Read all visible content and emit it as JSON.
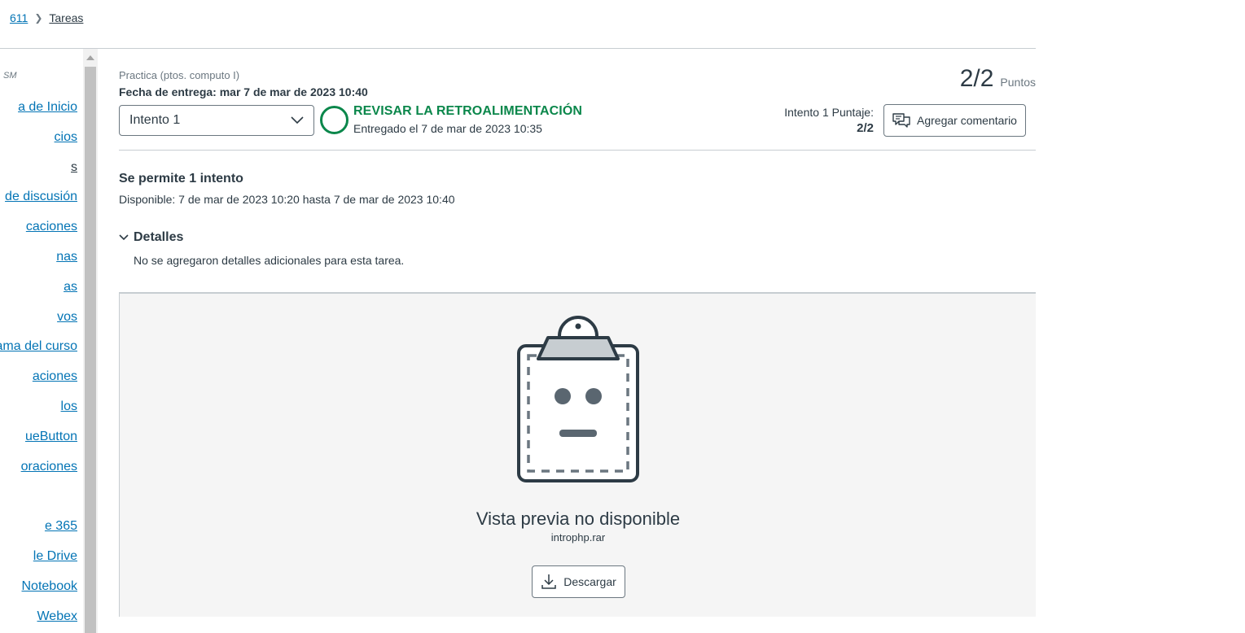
{
  "breadcrumb": {
    "course": "611",
    "section": "Tareas"
  },
  "sidebar": {
    "term": "SM",
    "items": [
      {
        "label": "a de Inicio"
      },
      {
        "label": "cios"
      },
      {
        "label": "s"
      },
      {
        "label": " de discusión"
      },
      {
        "label": "caciones"
      },
      {
        "label": "nas"
      },
      {
        "label": "as"
      },
      {
        "label": "vos"
      },
      {
        "label": "ama del curso"
      },
      {
        "label": "aciones"
      },
      {
        "label": "los"
      },
      {
        "label": "ueButton"
      },
      {
        "label": "oraciones"
      },
      {
        "label": "e 365"
      },
      {
        "label": "le Drive"
      },
      {
        "label": " Notebook"
      },
      {
        "label": " Webex"
      }
    ]
  },
  "assignment": {
    "practice_label": "Practica (ptos. computo I)",
    "due_date": "Fecha de entrega: mar 7 de mar de 2023 10:40",
    "score": "2/2",
    "score_unit": "Puntos",
    "attempt_selected": "Intento 1",
    "status_title": "REVISAR LA RETROALIMENTACIÓN",
    "status_sub": "Entregado el 7 de mar de 2023 10:35",
    "attempt_score_label": "Intento 1 Puntaje:",
    "attempt_score_value": "2/2",
    "comment_button": "Agregar comentario",
    "attempts_allowed": "Se permite 1 intento",
    "available": "Disponible: 7 de mar de 2023 10:20 hasta 7 de mar de 2023 10:40",
    "details_label": "Detalles",
    "details_text": "No se agregaron detalles adicionales para esta tarea."
  },
  "preview": {
    "title": "Vista previa no disponible",
    "filename": "introphp.rar",
    "download_label": "Descargar"
  },
  "colors": {
    "link": "#0374b5",
    "success": "#0b874b",
    "text": "#2d3b45"
  }
}
